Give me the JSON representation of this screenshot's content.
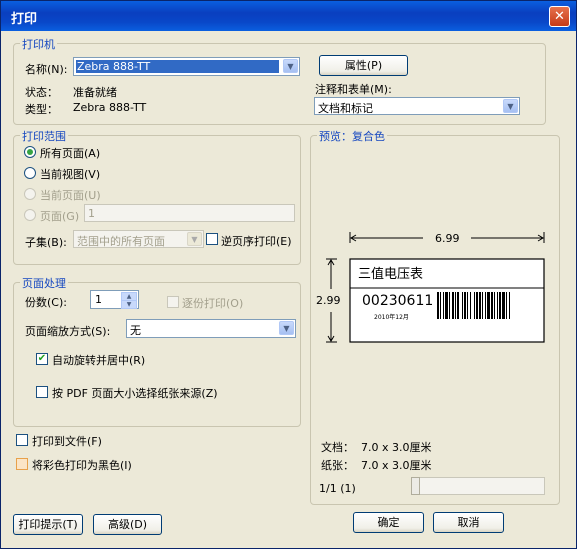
{
  "window": {
    "title": "打印",
    "close": "✕"
  },
  "printer": {
    "group_title": "打印机",
    "name_label": "名称(N):",
    "name_value": "Zebra 888-TT",
    "status_label": "状态：",
    "status_value": "准备就绪",
    "type_label": "类型：",
    "type_value": "Zebra 888-TT",
    "properties_button": "属性(P)",
    "comments_label": "注释和表单(M):",
    "comments_value": "文档和标记"
  },
  "range": {
    "group_title": "打印范围",
    "all_pages": "所有页面(A)",
    "current_view": "当前视图(V)",
    "current_page": "当前页面(U)",
    "pages": "页面(G)",
    "pages_value": "1",
    "subset_label": "子集(B):",
    "subset_value": "范围中的所有页面",
    "reverse": "逆页序打印(E)"
  },
  "handling": {
    "group_title": "页面处理",
    "copies_label": "份数(C):",
    "copies_value": "1",
    "collate": "逐份打印(O)",
    "scaling_label": "页面缩放方式(S):",
    "scaling_value": "无",
    "auto_rotate": "自动旋转并居中(R)",
    "choose_paper": "按 PDF 页面大小选择纸张来源(Z)"
  },
  "options": {
    "print_to_file": "打印到文件(F)",
    "print_color_as_black": "将彩色打印为黑色(I)"
  },
  "preview": {
    "title": "预览：复合色",
    "width_dim": "6.99",
    "height_dim": "2.99",
    "label_title": "三值电压表",
    "label_code": "00230611",
    "label_date": "2010年12月",
    "document_label": "文档：",
    "document_value": "7.0 x 3.0厘米",
    "paper_label": "纸张：",
    "paper_value": "7.0 x 3.0厘米",
    "page_counter": "1/1 (1)"
  },
  "buttons": {
    "print_tips": "打印提示(T)",
    "advanced": "高级(D)",
    "ok": "确定",
    "cancel": "取消"
  }
}
